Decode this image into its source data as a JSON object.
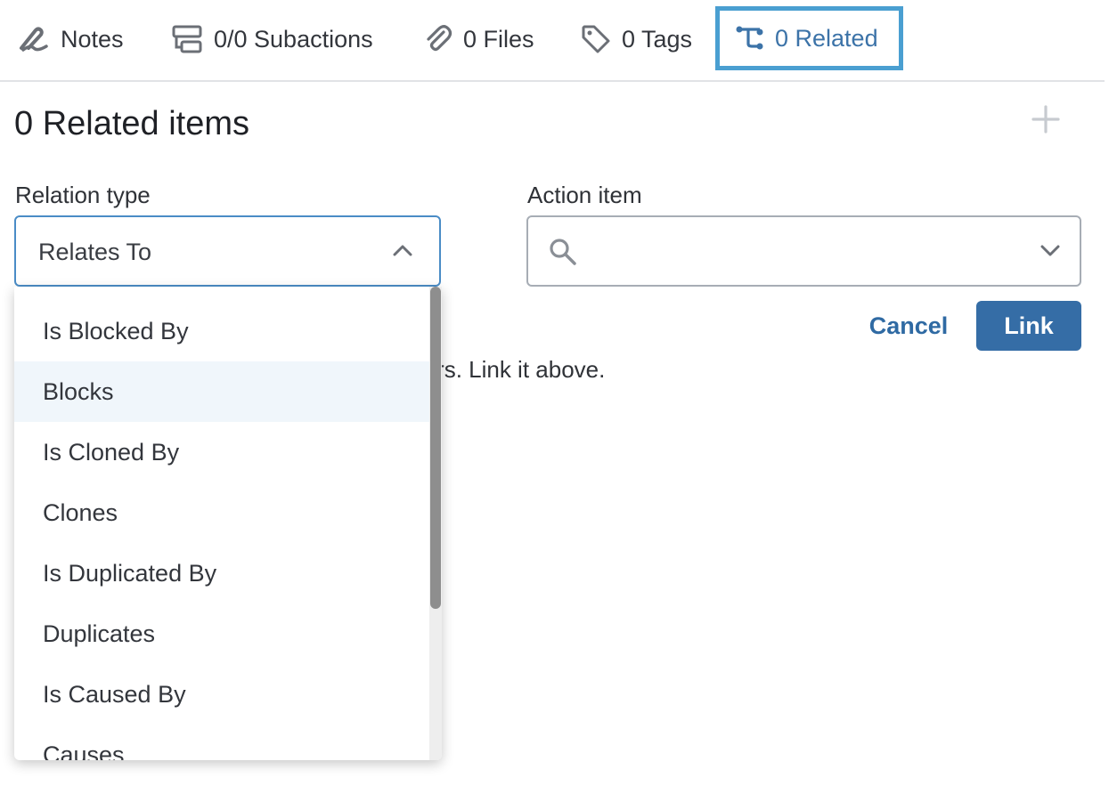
{
  "tabs": {
    "notes": "Notes",
    "subactions": "0/0 Subactions",
    "files": "0 Files",
    "tags": "0 Tags",
    "related": "0 Related"
  },
  "section": {
    "title": "0 Related items"
  },
  "form": {
    "relation_label": "Relation type",
    "relation_value": "Relates To",
    "action_label": "Action item",
    "action_value": "",
    "cancel_label": "Cancel",
    "link_label": "Link"
  },
  "empty_message": "This action item is not related to any others. Link it above.",
  "dropdown": {
    "options": [
      "Is Blocked By",
      "Blocks",
      "Is Cloned By",
      "Clones",
      "Is Duplicated By",
      "Duplicates",
      "Is Caused By",
      "Causes"
    ],
    "hovered": "Blocks"
  },
  "colors": {
    "accent": "#356da6",
    "active_tab_border": "#4a9fd1",
    "hover_row": "#f0f6fb"
  },
  "icons": {
    "notes": "pen-scribble-icon",
    "subactions": "subactions-icon",
    "files": "paperclip-icon",
    "tags": "tag-icon",
    "related": "related-branch-icon",
    "add": "plus-icon",
    "search": "search-icon"
  }
}
